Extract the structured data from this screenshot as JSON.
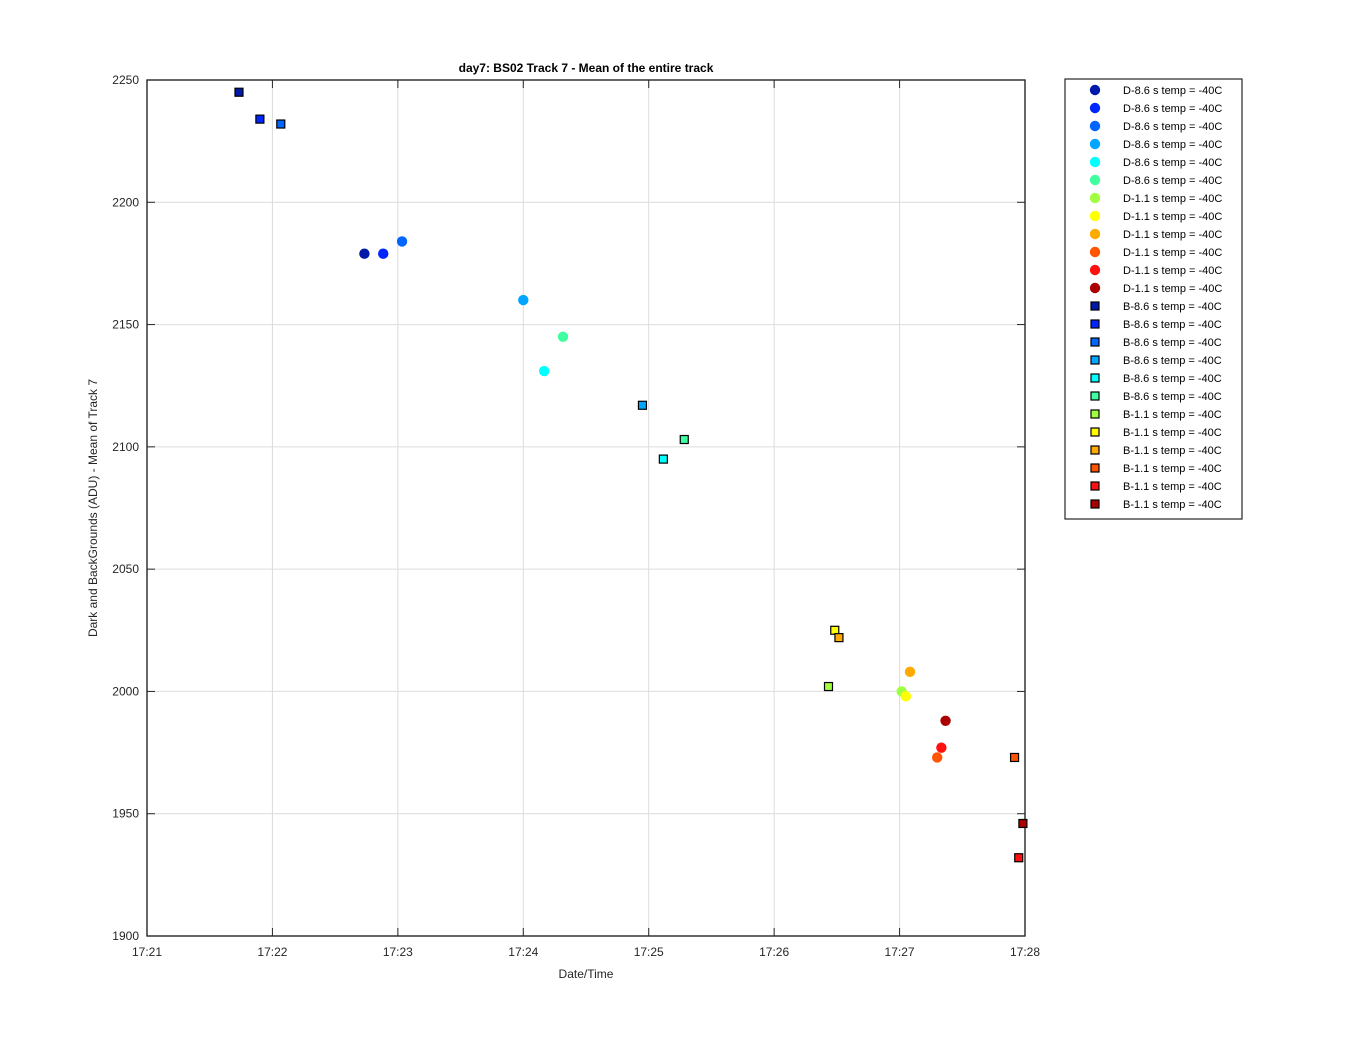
{
  "chart_data": {
    "type": "scatter",
    "title": "day7: BS02  Track 7 - Mean of the entire track",
    "xlabel": "Date/Time",
    "ylabel": "Dark and BackGrounds (ADU) - Mean of Track 7",
    "x_unit": "time (HH:MM)",
    "xlim": [
      "17:21",
      "17:28"
    ],
    "ylim": [
      1900,
      2250
    ],
    "xticks": [
      "17:21",
      "17:22",
      "17:23",
      "17:24",
      "17:25",
      "17:26",
      "17:27",
      "17:28"
    ],
    "yticks": [
      1900,
      1950,
      2000,
      2050,
      2100,
      2150,
      2200,
      2250
    ],
    "grid": true,
    "legend_position": "outside-right",
    "series": [
      {
        "name": "D-8.6 s temp = -40C",
        "marker": "circle",
        "color": "#0019a8",
        "points": [
          {
            "x": "17:22:44",
            "y": 2179
          }
        ]
      },
      {
        "name": "D-8.6 s temp = -40C",
        "marker": "circle",
        "color": "#0026ff",
        "points": [
          {
            "x": "17:22:53",
            "y": 2179
          }
        ]
      },
      {
        "name": "D-8.6 s temp = -40C",
        "marker": "circle",
        "color": "#0066ff",
        "points": [
          {
            "x": "17:23:02",
            "y": 2184
          }
        ]
      },
      {
        "name": "D-8.6 s temp = -40C",
        "marker": "circle",
        "color": "#00a6ff",
        "points": [
          {
            "x": "17:24:00",
            "y": 2160
          }
        ]
      },
      {
        "name": "D-8.6 s temp = -40C",
        "marker": "circle",
        "color": "#00ffff",
        "points": [
          {
            "x": "17:24:10",
            "y": 2131
          }
        ]
      },
      {
        "name": "D-8.6 s temp = -40C",
        "marker": "circle",
        "color": "#40ffa0",
        "points": [
          {
            "x": "17:24:19",
            "y": 2145
          }
        ]
      },
      {
        "name": "D-1.1 s temp = -40C",
        "marker": "circle",
        "color": "#a0ff40",
        "points": [
          {
            "x": "17:27:01",
            "y": 2000
          }
        ]
      },
      {
        "name": "D-1.1 s temp = -40C",
        "marker": "circle",
        "color": "#ffff00",
        "points": [
          {
            "x": "17:27:03",
            "y": 1998
          }
        ]
      },
      {
        "name": "D-1.1 s temp = -40C",
        "marker": "circle",
        "color": "#ffaa00",
        "points": [
          {
            "x": "17:27:05",
            "y": 2008
          }
        ]
      },
      {
        "name": "D-1.1 s temp = -40C",
        "marker": "circle",
        "color": "#ff5500",
        "points": [
          {
            "x": "17:27:18",
            "y": 1973
          }
        ]
      },
      {
        "name": "D-1.1 s temp = -40C",
        "marker": "circle",
        "color": "#ff1010",
        "points": [
          {
            "x": "17:27:20",
            "y": 1977
          }
        ]
      },
      {
        "name": "D-1.1 s temp = -40C",
        "marker": "circle",
        "color": "#aa0000",
        "points": [
          {
            "x": "17:27:22",
            "y": 1988
          }
        ]
      },
      {
        "name": "B-8.6 s temp = -40C",
        "marker": "square",
        "color": "#0019a8",
        "points": [
          {
            "x": "17:21:44",
            "y": 2245
          }
        ]
      },
      {
        "name": "B-8.6 s temp = -40C",
        "marker": "square",
        "color": "#0026ff",
        "points": [
          {
            "x": "17:21:54",
            "y": 2234
          }
        ]
      },
      {
        "name": "B-8.6 s temp = -40C",
        "marker": "square",
        "color": "#0066ff",
        "points": [
          {
            "x": "17:22:04",
            "y": 2232
          }
        ]
      },
      {
        "name": "B-8.6 s temp = -40C",
        "marker": "square",
        "color": "#00a6ff",
        "points": [
          {
            "x": "17:24:57",
            "y": 2117
          }
        ]
      },
      {
        "name": "B-8.6 s temp = -40C",
        "marker": "square",
        "color": "#00ffff",
        "points": [
          {
            "x": "17:25:07",
            "y": 2095
          }
        ]
      },
      {
        "name": "B-8.6 s temp = -40C",
        "marker": "square",
        "color": "#40ffa0",
        "points": [
          {
            "x": "17:25:17",
            "y": 2103
          }
        ]
      },
      {
        "name": "B-1.1 s temp = -40C",
        "marker": "square",
        "color": "#a0ff40",
        "points": [
          {
            "x": "17:26:26",
            "y": 2002
          }
        ]
      },
      {
        "name": "B-1.1 s temp = -40C",
        "marker": "square",
        "color": "#ffff00",
        "points": [
          {
            "x": "17:26:29",
            "y": 2025
          }
        ]
      },
      {
        "name": "B-1.1 s temp = -40C",
        "marker": "square",
        "color": "#ffaa00",
        "points": [
          {
            "x": "17:26:31",
            "y": 2022
          }
        ]
      },
      {
        "name": "B-1.1 s temp = -40C",
        "marker": "square",
        "color": "#ff5500",
        "points": [
          {
            "x": "17:27:55",
            "y": 1973
          }
        ]
      },
      {
        "name": "B-1.1 s temp = -40C",
        "marker": "square",
        "color": "#ff1010",
        "points": [
          {
            "x": "17:27:57",
            "y": 1932
          }
        ]
      },
      {
        "name": "B-1.1 s temp = -40C",
        "marker": "square",
        "color": "#aa0000",
        "points": [
          {
            "x": "17:27:59",
            "y": 1946
          }
        ]
      }
    ]
  }
}
